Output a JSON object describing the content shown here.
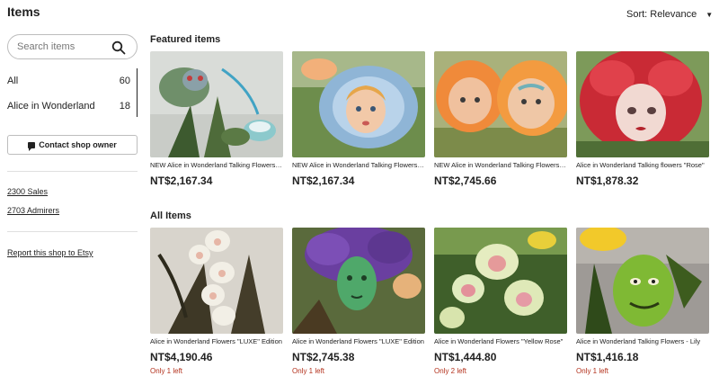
{
  "header": {
    "title": "Items",
    "sort_label": "Sort: Relevance"
  },
  "sidebar": {
    "search_placeholder": "Search items",
    "categories": [
      {
        "label": "All",
        "count": "60"
      },
      {
        "label": "Alice in Wonderland",
        "count": "18"
      }
    ],
    "contact_label": "Contact shop owner",
    "sales": "2300 Sales",
    "admirers": "2703 Admirers",
    "report": "Report this shop to Etsy"
  },
  "featured": {
    "title": "Featured items",
    "items": [
      {
        "title": "NEW Alice in Wonderland Talking Flowers \"LUXE\" Edition",
        "price": "NT$2,167.34"
      },
      {
        "title": "NEW Alice in Wonderland Talking Flowers \"LUXE\" Edition",
        "price": "NT$2,167.34"
      },
      {
        "title": "NEW Alice in Wonderland Talking Flowers \"LUXE\" Edition",
        "price": "NT$2,745.66"
      },
      {
        "title": "Alice in Wonderland Talking flowers \"Rose\"",
        "price": "NT$1,878.32"
      }
    ]
  },
  "all_items": {
    "title": "All Items",
    "items": [
      {
        "title": "Alice in Wonderland Flowers \"LUXE\" Edition",
        "price": "NT$4,190.46",
        "stock": "Only 1 left"
      },
      {
        "title": "Alice in Wonderland Flowers \"LUXE\" Edition",
        "price": "NT$2,745.38",
        "stock": "Only 1 left"
      },
      {
        "title": "Alice in Wonderland Flowers \"Yellow Rose\"",
        "price": "NT$1,444.80",
        "stock": "Only 2 left"
      },
      {
        "title": "Alice in Wonderland Talking Flowers - Lily",
        "price": "NT$1,416.18",
        "stock": "Only 1 left"
      }
    ]
  },
  "icons": {
    "search": "search-icon",
    "contact": "chat-bubble-icon",
    "sort": "caret-down-icon"
  }
}
